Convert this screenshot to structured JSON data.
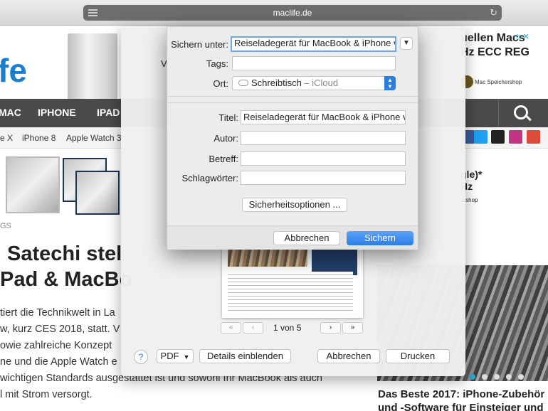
{
  "browser": {
    "url": "maclife.de"
  },
  "site": {
    "logo": "fe",
    "ad_top": {
      "line1": "uellen Macs",
      "line2": "Hz ECC REG",
      "shop": "Mac Speichershop"
    },
    "nav": [
      "MAC",
      "IPHONE",
      "IPAD"
    ],
    "subnav": [
      "e X",
      "iPhone 8",
      "Apple Watch 3"
    ],
    "tags_label": "GS",
    "headline": [
      "Satechi stel",
      "Pad & MacBo"
    ],
    "article": [
      "tiert die Technikwelt in La",
      "w, kurz CES 2018, statt. V",
      "owie zahlreiche Konzept",
      "ne und die Apple Watch e",
      " wichtigen Standards ausgestattet ist und sowohl Ihr MacBook als auch",
      "l mit Strom versorgt."
    ],
    "ad_right2": {
      "line1": "gle)*",
      "line2": "Hz",
      "line3": "ershop"
    },
    "right_headline": [
      "Das Beste 2017: iPhone-Zubehör",
      "und -Software für Einsteiger und"
    ],
    "social_colors": [
      "#3b5998",
      "#1da1f2",
      "#222222",
      "#c13584",
      "#dd4b39"
    ]
  },
  "print_dialog": {
    "v_label": "V",
    "page_count": "1 von 5",
    "pager": {
      "first": "«",
      "prev": "‹",
      "next": "›",
      "last": "»"
    },
    "help": "?",
    "pdf_label": "PDF",
    "details_label": "Details einblenden",
    "cancel_label": "Abbrechen",
    "print_label": "Drucken"
  },
  "save_dialog": {
    "save_as_label": "Sichern unter:",
    "save_as_value": "Reiseladegerät für MacBook & iPhone vo",
    "tags_label": "Tags:",
    "location_label": "Ort:",
    "location_name": "Schreibtisch",
    "location_suffix": " – iCloud",
    "title_label": "Titel:",
    "title_value": "Reiseladegerät für MacBook & iPhone vo",
    "author_label": "Autor:",
    "subject_label": "Betreff:",
    "keywords_label": "Schlagwörter:",
    "security_button": "Sicherheitsoptionen ...",
    "cancel_button": "Abbrechen",
    "save_button": "Sichern"
  }
}
